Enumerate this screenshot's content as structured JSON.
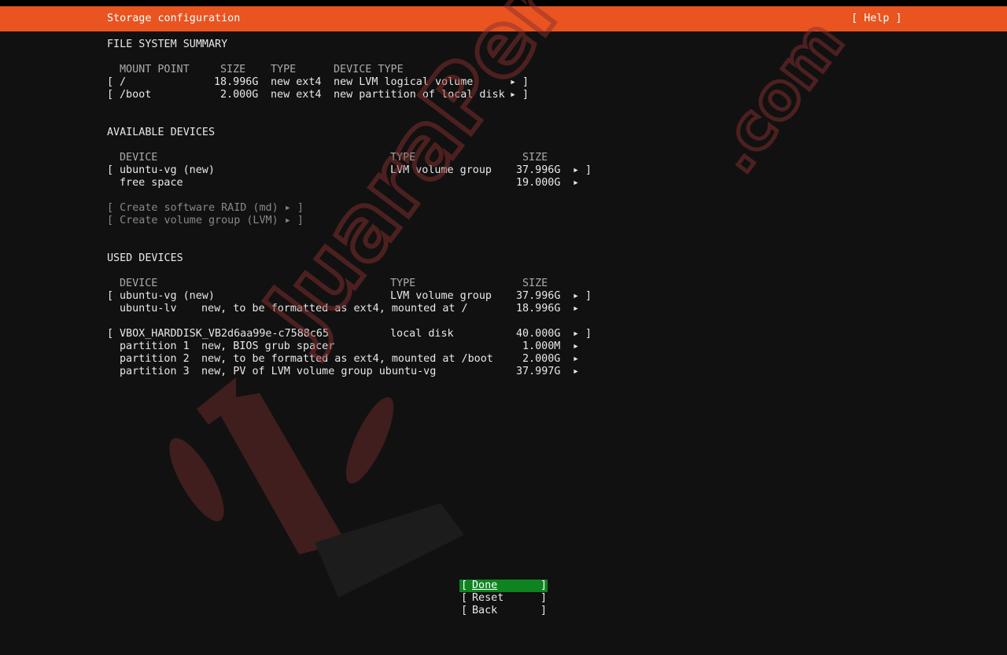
{
  "header": {
    "title": "Storage configuration",
    "help": "[ Help ]"
  },
  "fs_summary": {
    "heading": "FILE SYSTEM SUMMARY",
    "columns": [
      "MOUNT POINT",
      "SIZE",
      "TYPE",
      "DEVICE TYPE"
    ],
    "rows": [
      {
        "open": "[",
        "mount": "/",
        "size": "18.996G",
        "type": "new ext4",
        "device_type": "new LVM logical volume",
        "arrow": "▸",
        "close": "]"
      },
      {
        "open": "[",
        "mount": "/boot",
        "size": "2.000G",
        "type": "new ext4",
        "device_type": "new partition of local disk",
        "arrow": "▸",
        "close": "]"
      }
    ]
  },
  "available": {
    "heading": "AVAILABLE DEVICES",
    "columns": [
      "DEVICE",
      "TYPE",
      "SIZE"
    ],
    "rows": [
      {
        "open": "[",
        "device": "ubuntu-vg (new)",
        "type": "LVM volume group",
        "size": "37.996G",
        "arrow": "▸",
        "close": "]"
      },
      {
        "device": "free space",
        "size": "19.000G",
        "arrow": "▸"
      }
    ],
    "actions": [
      "[ Create software RAID (md) ▸ ]",
      "[ Create volume group (LVM) ▸ ]"
    ]
  },
  "used": {
    "heading": "USED DEVICES",
    "columns": [
      "DEVICE",
      "TYPE",
      "SIZE"
    ],
    "rows": [
      {
        "open": "[",
        "device": "ubuntu-vg (new)",
        "type": "LVM volume group",
        "size": "37.996G",
        "arrow": "▸",
        "close": "]"
      },
      {
        "device": "ubuntu-lv",
        "desc": "new, to be formatted as ext4, mounted at /",
        "size": "18.996G",
        "arrow": "▸"
      },
      {
        "open": "[",
        "device": "VBOX_HARDDISK_VB2d6aa99e-c7588c65",
        "type": "local disk",
        "size": "40.000G",
        "arrow": "▸",
        "close": "]"
      },
      {
        "device": "partition 1",
        "desc": "new, BIOS grub spacer",
        "size": "1.000M",
        "arrow": "▸"
      },
      {
        "device": "partition 2",
        "desc": "new, to be formatted as ext4, mounted at /boot",
        "size": "2.000G",
        "arrow": "▸"
      },
      {
        "device": "partition 3",
        "desc": "new, PV of LVM volume group ubuntu-vg",
        "size": "37.997G",
        "arrow": "▸"
      }
    ]
  },
  "buttons": [
    {
      "label": "Done",
      "open": "[",
      "close": "]"
    },
    {
      "label": "Reset",
      "open": "[",
      "close": "]"
    },
    {
      "label": "Back",
      "open": "[",
      "close": "]"
    }
  ],
  "watermark": {
    "text": "JuaraPertama",
    "suffix": ".com"
  },
  "colors": {
    "accent": "#e95420",
    "focus": "#0e8420",
    "background": "#111111"
  }
}
